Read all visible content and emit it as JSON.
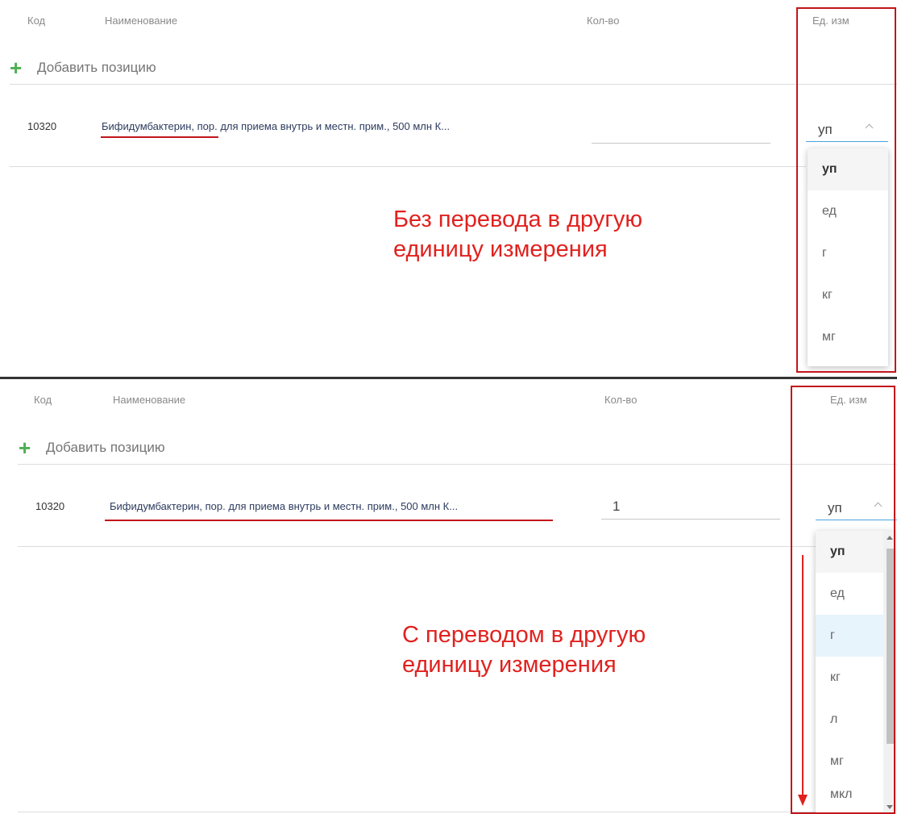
{
  "colors": {
    "accent_plus": "#4caf50",
    "annotation_red": "#e0221f",
    "focus_underline": "#4aa3df",
    "highlight_option": "#e8f4fb"
  },
  "icons": {
    "add": "plus-icon",
    "dropdown": "chevron-up-icon"
  },
  "panel1": {
    "headers": {
      "code": "Код",
      "name": "Наименование",
      "qty": "Кол-во",
      "unit": "Ед. изм"
    },
    "add_label": "Добавить позицию",
    "row": {
      "code": "10320",
      "name": "Бифидумбактерин, пор. для приема внутрь и местн. прим., 500 млн К...",
      "qty": "",
      "unit": "уп"
    },
    "options": [
      "уп",
      "ед",
      "г",
      "кг",
      "мг"
    ],
    "selected_option": "уп",
    "annotation": [
      "Без перевода в другую",
      "единицу измерения"
    ]
  },
  "panel2": {
    "headers": {
      "code": "Код",
      "name": "Наименование",
      "qty": "Кол-во",
      "unit": "Ед. изм"
    },
    "add_label": "Добавить позицию",
    "row": {
      "code": "10320",
      "name": "Бифидумбактерин, пор. для приема внутрь и местн. прим., 500 млн К...",
      "qty": "1",
      "unit": "уп"
    },
    "options": [
      "уп",
      "ед",
      "г",
      "кг",
      "л",
      "мг",
      "мкл"
    ],
    "selected_option": "уп",
    "hovered_option": "г",
    "annotation": [
      "С переводом в другую",
      "единицу измерения"
    ]
  }
}
